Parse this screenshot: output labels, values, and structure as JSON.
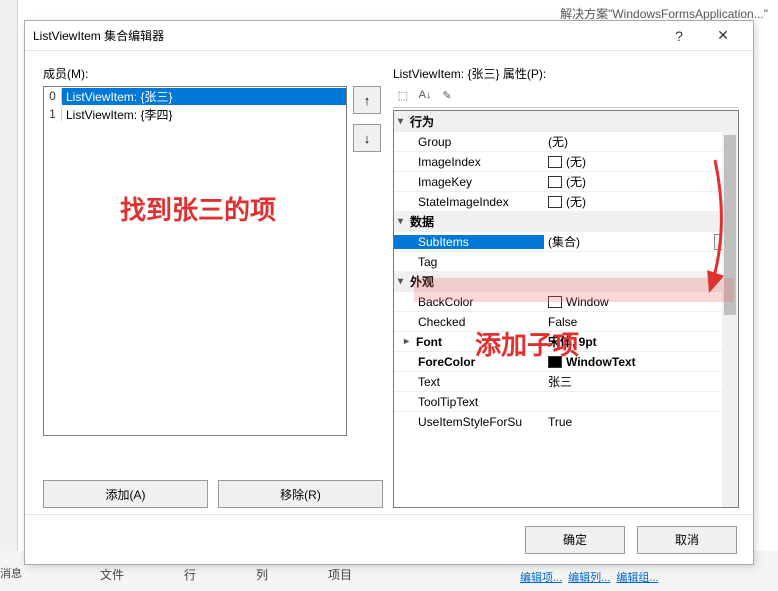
{
  "bg": {
    "solution_hint": "解决方案\"WindowsFormsApplication...\"",
    "msg": "消息",
    "cols": [
      "文件",
      "行",
      "列",
      "项目"
    ],
    "links": [
      "编辑项...",
      "编辑列...",
      "编辑组..."
    ]
  },
  "dialog": {
    "title": "ListViewItem 集合编辑器",
    "help": "?",
    "close": "✕"
  },
  "members": {
    "label": "成员(M):",
    "items": [
      {
        "idx": "0",
        "text": "ListViewItem: {张三}",
        "selected": true
      },
      {
        "idx": "1",
        "text": "ListViewItem: {李四}",
        "selected": false
      }
    ],
    "up": "↑",
    "down": "↓",
    "add": "添加(A)",
    "remove": "移除(R)"
  },
  "props": {
    "label": "ListViewItem: {张三} 属性(P):",
    "toolbar": [
      "⬚",
      "A↓",
      "✎"
    ],
    "cats": {
      "behavior": "行为",
      "data": "数据",
      "appearance": "外观"
    },
    "rows": {
      "Group": "(无)",
      "ImageIndex": "(无)",
      "ImageKey": "(无)",
      "StateImageIndex": "(无)",
      "SubItems": "(集合)",
      "Tag": "",
      "BackColor": "Window",
      "Checked": "False",
      "Font": "宋体, 9pt",
      "ForeColor": "WindowText",
      "Text": "张三",
      "ToolTipText": "",
      "UseItemStyleForSubItems": "True"
    },
    "ellipsis": "..."
  },
  "footer": {
    "ok": "确定",
    "cancel": "取消"
  },
  "annotations": {
    "a1": "找到张三的项",
    "a2": "添加子项"
  }
}
